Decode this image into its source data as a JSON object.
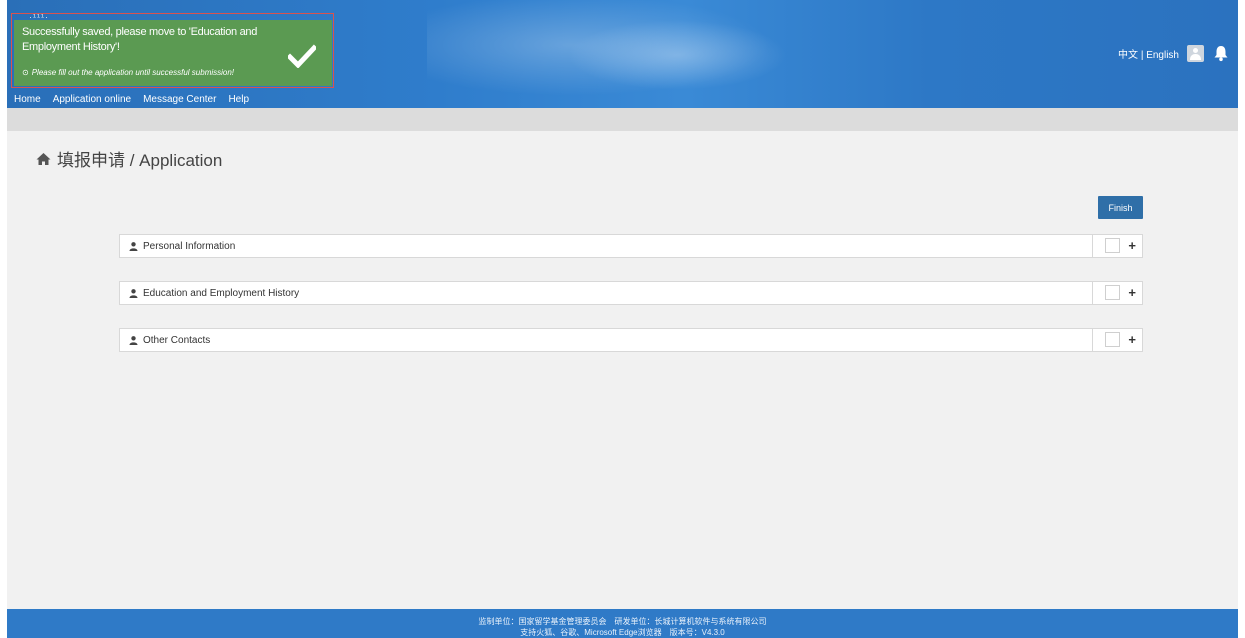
{
  "header": {
    "nav": [
      "Home",
      "Application online",
      "Message Center",
      "Help"
    ],
    "lang": "中文 | English",
    "logo_dots": "·¹¹¹·"
  },
  "toast": {
    "message": "Successfully saved, please move to 'Education and Employment History'!",
    "sub_icon": "⊙",
    "sub": "Please fill out the application until successful submission!"
  },
  "page": {
    "title": "填报申请 / Application",
    "finish_label": "Finish"
  },
  "sections": [
    {
      "label": "Personal Information",
      "expand": "+"
    },
    {
      "label": "Education and Employment History",
      "expand": "+"
    },
    {
      "label": "Other Contacts",
      "expand": "+"
    }
  ],
  "footer": {
    "line1": "监制单位：国家留学基金管理委员会　研发单位：长城计算机软件与系统有限公司",
    "line2": "支持火狐、谷歌、Microsoft Edge浏览器　版本号：V4.3.0"
  },
  "colors": {
    "header": "#2f7dcc",
    "toast": "#5b9a52",
    "toast_border": "#d9534f",
    "finish": "#2f6fa8",
    "footer": "#2f7ac7"
  },
  "icons": [
    "home-icon",
    "user-icon",
    "check-icon",
    "bell-icon",
    "avatar-icon",
    "plus-icon",
    "info-circle-icon"
  ]
}
